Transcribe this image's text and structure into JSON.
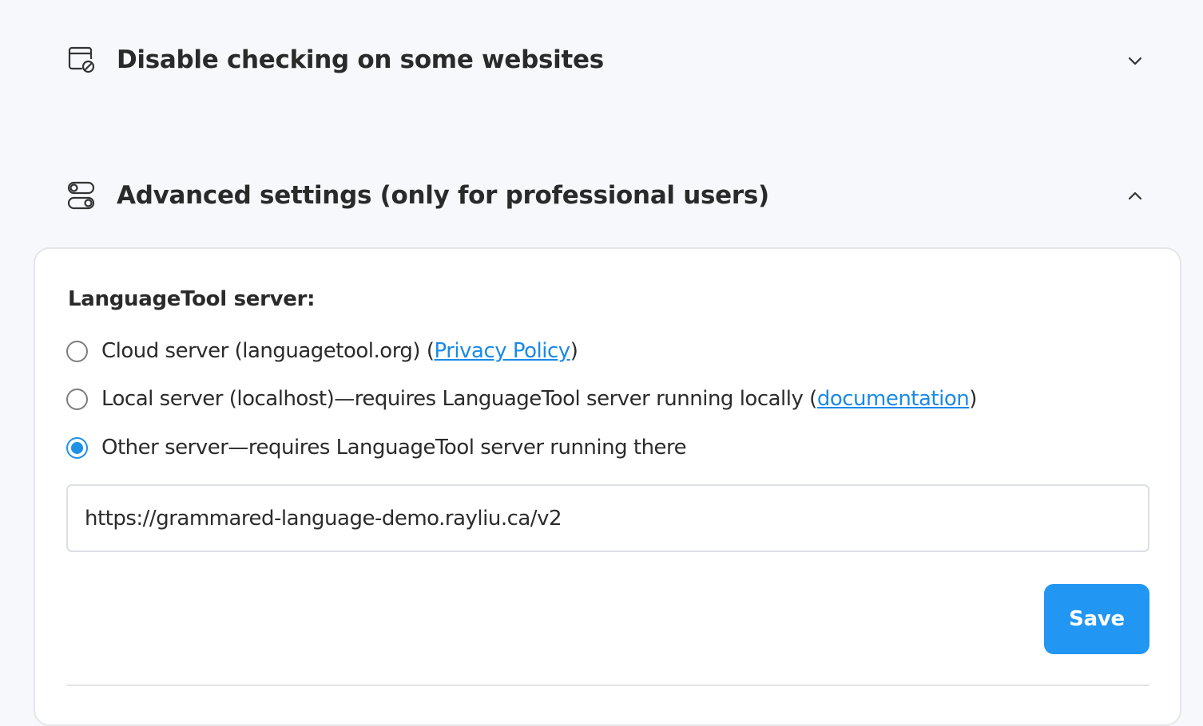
{
  "sections": {
    "disable_checking": {
      "title": "Disable checking on some websites",
      "icon": "browser-blocked-icon",
      "expanded": false
    },
    "advanced": {
      "title": "Advanced settings (only for professional users)",
      "icon": "toggles-icon",
      "expanded": true
    }
  },
  "advanced_panel": {
    "server_label": "LanguageTool server:",
    "options": [
      {
        "id": "cloud",
        "text": "Cloud server (languagetool.org) (",
        "link_text": "Privacy Policy",
        "suffix": ")",
        "checked": false
      },
      {
        "id": "local",
        "text": "Local server (localhost)—requires LanguageTool server running locally (",
        "link_text": "documentation",
        "suffix": ")",
        "checked": false
      },
      {
        "id": "other",
        "text": "Other server—requires LanguageTool server running there",
        "checked": true
      }
    ],
    "server_url": "https://grammared-language-demo.rayliu.ca/v2",
    "save_label": "Save"
  },
  "colors": {
    "accent": "#2196f3",
    "link": "#1a8ae8",
    "background": "#f7f8fb",
    "card": "#ffffff"
  }
}
